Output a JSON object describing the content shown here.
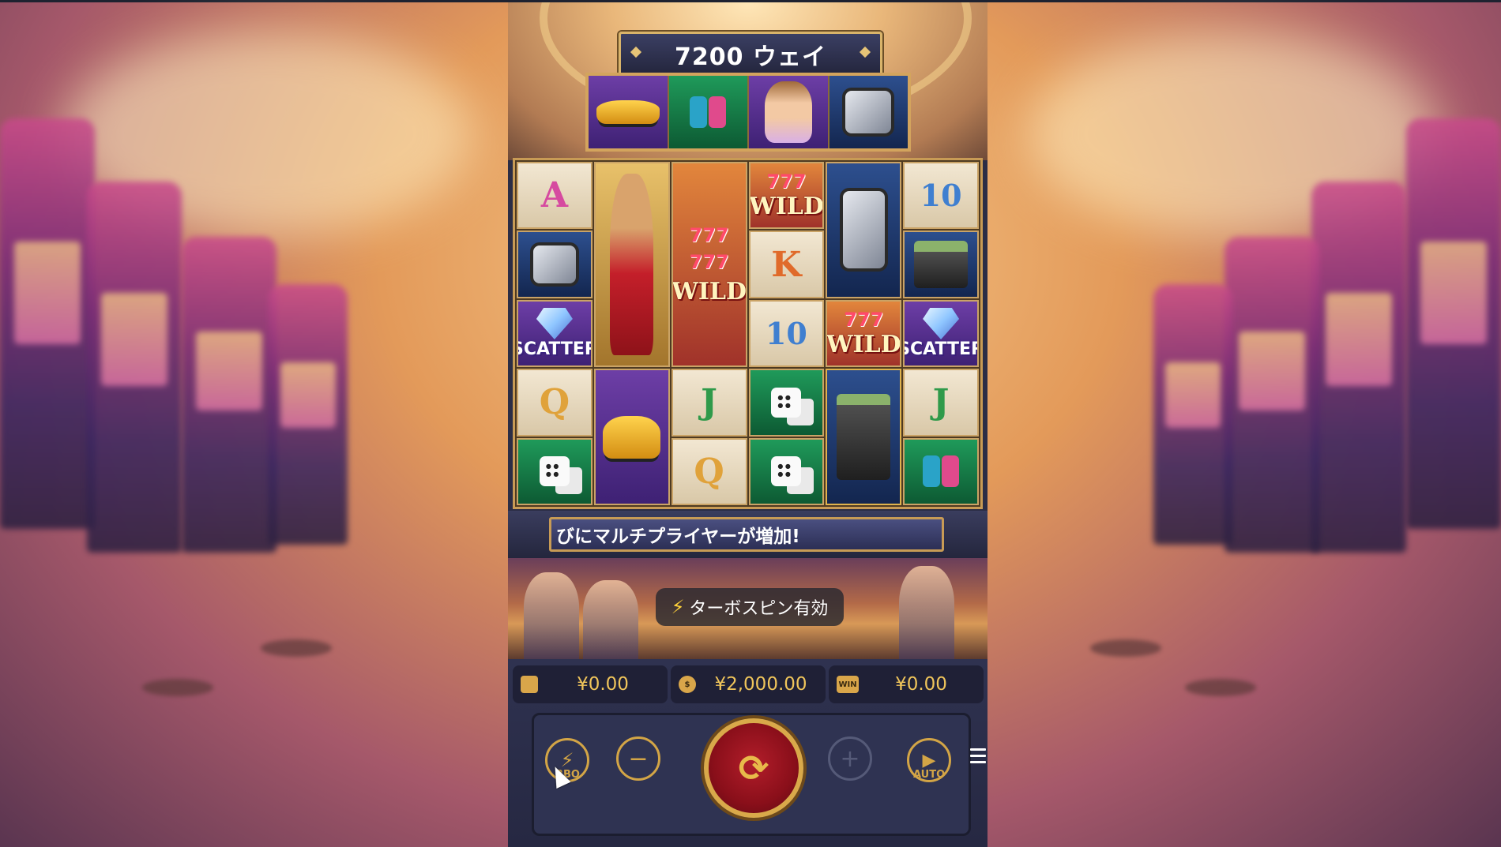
{
  "header": {
    "ways_title": "7200 ウェイ"
  },
  "symbols": {
    "wild": "WILD",
    "scatter": "SCATTER",
    "sevens": "777",
    "letter_a": "A",
    "letter_k": "K",
    "letter_q": "Q",
    "letter_j": "J",
    "ten": "10"
  },
  "banner": {
    "text": "びにマルチプライヤーが増加!"
  },
  "toast": {
    "text": "ターボスピン有効"
  },
  "stats": {
    "bet": "¥0.00",
    "balance": "¥2,000.00",
    "win": "¥0.00",
    "win_icon_label": "WIN"
  },
  "controls": {
    "turbo_label": "RBO",
    "auto_label": "AUTO",
    "minus": "−",
    "plus": "+"
  },
  "colors": {
    "gold": "#d3a546",
    "amount": "#f0c55b",
    "spin_red": "#8a0f1a"
  }
}
